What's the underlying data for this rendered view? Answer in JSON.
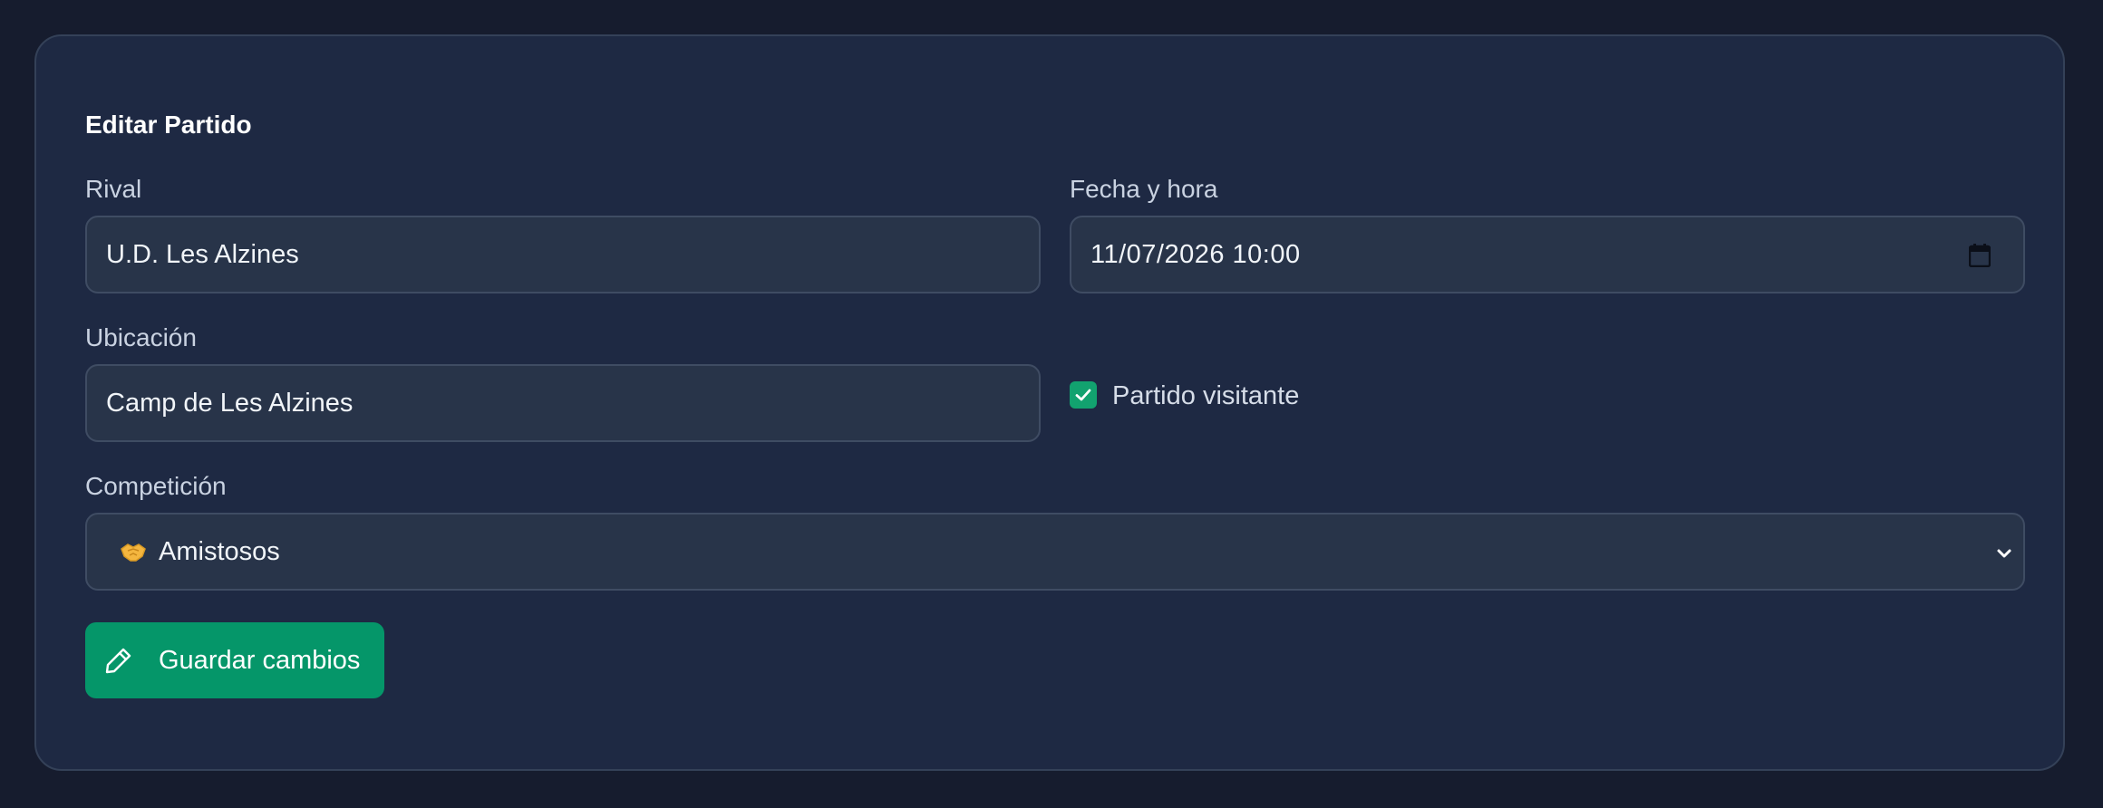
{
  "form": {
    "title": "Editar Partido",
    "rival": {
      "label": "Rival",
      "value": "U.D. Les Alzines"
    },
    "datetime": {
      "label": "Fecha y hora",
      "value": "11/07/2026 10:00"
    },
    "location": {
      "label": "Ubicación",
      "value": "Camp de Les Alzines"
    },
    "away_match": {
      "label": "Partido visitante",
      "checked": true
    },
    "competition": {
      "label": "Competición",
      "selected": "Amistosos",
      "icon": "handshake-emoji"
    },
    "save_label": "Guardar cambios"
  },
  "colors": {
    "background": "#161c2e",
    "card": "#1e2943",
    "input": "#283449",
    "accent": "#059669"
  }
}
